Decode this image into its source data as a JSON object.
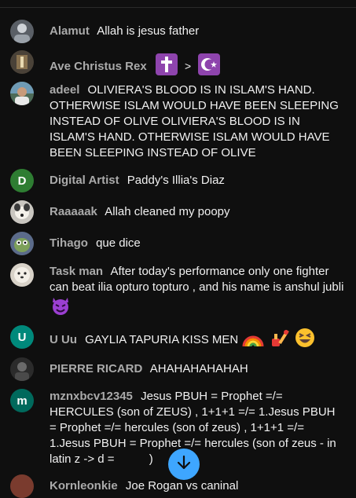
{
  "messages": [
    {
      "author": "Alamut",
      "text": "Allah is jesus father",
      "avatar_initial": "",
      "avatar_color": "#5a5f66"
    },
    {
      "author": "Ave Christus Rex",
      "text": "",
      "separator": ">",
      "avatar_initial": "",
      "avatar_color": "#4a4238"
    },
    {
      "author": "adeel",
      "text": "OLIVIERA'S BLOOD IS IN ISLAM'S HAND. OTHERWISE ISLAM WOULD HAVE BEEN SLEEPING INSTEAD OF OLIVE OLIVIERA'S BLOOD IS IN ISLAM'S HAND. OTHERWISE ISLAM WOULD HAVE BEEN SLEEPING INSTEAD OF OLIVE",
      "avatar_initial": "",
      "avatar_color": "#4d6b58"
    },
    {
      "author": "Digital Artist",
      "text": "Paddy's Illia's Diaz",
      "avatar_initial": "D",
      "avatar_color": "#2e7d32"
    },
    {
      "author": "Raaaaak",
      "text": "Allah cleaned my poopy",
      "avatar_initial": "",
      "avatar_color": "#c9c6c0"
    },
    {
      "author": "Tihago",
      "text": "que dice",
      "avatar_initial": "",
      "avatar_color": "#5b6b8a"
    },
    {
      "author": "Task man",
      "text": "After today's performance only one fighter can beat ilia opturo topturo , and his name is anshul jubli",
      "avatar_initial": "",
      "avatar_color": "#d8d2c8"
    },
    {
      "author": "U Uu",
      "text": "GAYLIA TAPURIA KISS MEN",
      "avatar_initial": "U",
      "avatar_color": "#00897b"
    },
    {
      "author": "PIERRE RICARD",
      "text": "AHAHAHAHAHAH",
      "avatar_initial": "",
      "avatar_color": "#2b2b2b"
    },
    {
      "author": "mznxbcv12345",
      "text": "Jesus PBUH = Prophet =/= HERCULES (son of ZEUS) , 1+1+1 =/= 1.Jesus PBUH = Prophet =/= hercules (son of zeus) , 1+1+1 =/= 1.Jesus PBUH = Prophet =/= hercules (son of zeus - in latin z -> d = ",
      "text_tail": ")",
      "avatar_initial": "m",
      "avatar_color": "#00695c"
    },
    {
      "author": "Kornleonkie",
      "text": "Joe Rogan vs caninal",
      "avatar_initial": "",
      "avatar_color": "#7a3b2e"
    }
  ],
  "icons": {
    "scroll": "arrow-down-icon",
    "cross": "latin-cross-icon",
    "crescent": "star-and-crescent-icon",
    "devil": "smiling-imp-icon",
    "rainbow": "rainbow-icon",
    "nails": "nail-polish-icon",
    "laugh": "grinning-squinting-face-icon"
  },
  "colors": {
    "background": "#0f0f0f",
    "author": "#aaaaaa",
    "text": "#f1f1f1",
    "accent": "#3ea6ff"
  }
}
